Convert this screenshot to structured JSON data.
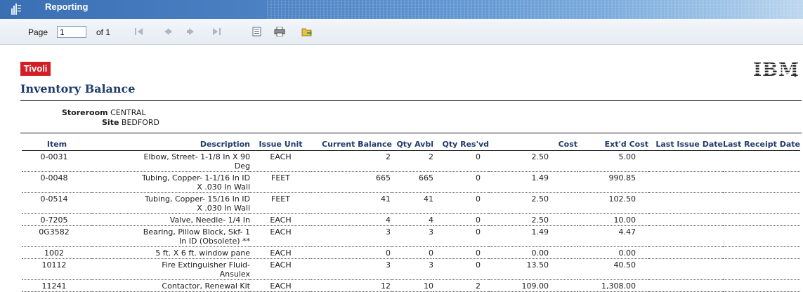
{
  "app": {
    "title": "Reporting"
  },
  "toolbar": {
    "page_label": "Page",
    "page_value": "1",
    "of_label": "of 1",
    "buttons": [
      "first-page",
      "previous-page",
      "next-page",
      "last-page",
      "table-of-contents",
      "print",
      "export"
    ]
  },
  "report": {
    "brand": "Tivoli",
    "vendor_logo": "IBM",
    "title": "Inventory Balance",
    "storeroom_label": "Storeroom",
    "storeroom_value": "CENTRAL",
    "site_label": "Site",
    "site_value": "BEDFORD",
    "columns": [
      "Item",
      "Description",
      "Issue Unit",
      "Current Balance",
      "Qty Avbl",
      "Qty Res'vd",
      "Cost",
      "Ext'd Cost",
      "Last Issue Date",
      "Last Receipt Date"
    ],
    "rows": [
      {
        "item": "0-0031",
        "desc1": "Elbow, Street- 1-1/8 In X 90",
        "desc2": "Deg",
        "unit": "EACH",
        "balance": "2",
        "avbl": "2",
        "resvd": "0",
        "cost": "2.50",
        "ext": "5.00",
        "last_issue": "",
        "last_receipt": ""
      },
      {
        "item": "0-0048",
        "desc1": "Tubing, Copper- 1-1/16 In ID",
        "desc2": "X .030 In Wall",
        "unit": "FEET",
        "balance": "665",
        "avbl": "665",
        "resvd": "0",
        "cost": "1.49",
        "ext": "990.85",
        "last_issue": "",
        "last_receipt": ""
      },
      {
        "item": "0-0514",
        "desc1": "Tubing, Copper- 15/16 In ID",
        "desc2": "X .030 In Wall",
        "unit": "FEET",
        "balance": "41",
        "avbl": "41",
        "resvd": "0",
        "cost": "2.50",
        "ext": "102.50",
        "last_issue": "",
        "last_receipt": ""
      },
      {
        "item": "0-7205",
        "desc1": "Valve, Needle- 1/4 In",
        "desc2": "",
        "unit": "EACH",
        "balance": "4",
        "avbl": "4",
        "resvd": "0",
        "cost": "2.50",
        "ext": "10.00",
        "last_issue": "",
        "last_receipt": ""
      },
      {
        "item": "0G3582",
        "desc1": "Bearing, Pillow Block, Skf- 1",
        "desc2": "In ID (Obsolete) **",
        "unit": "EACH",
        "balance": "3",
        "avbl": "3",
        "resvd": "0",
        "cost": "1.49",
        "ext": "4.47",
        "last_issue": "",
        "last_receipt": ""
      },
      {
        "item": "1002",
        "desc1": "5 ft. X 6 ft. window pane",
        "desc2": "",
        "unit": "EACH",
        "balance": "0",
        "avbl": "0",
        "resvd": "0",
        "cost": "0.00",
        "ext": "0.00",
        "last_issue": "",
        "last_receipt": ""
      },
      {
        "item": "10112",
        "desc1": "Fire Extinguisher Fluid-",
        "desc2": "Ansulex",
        "unit": "EACH",
        "balance": "3",
        "avbl": "3",
        "resvd": "0",
        "cost": "13.50",
        "ext": "40.50",
        "last_issue": "",
        "last_receipt": ""
      },
      {
        "item": "11241",
        "desc1": "Contactor, Renewal Kit",
        "desc2": "",
        "unit": "EACH",
        "balance": "12",
        "avbl": "10",
        "resvd": "2",
        "cost": "109.00",
        "ext": "1,308.00",
        "last_issue": "",
        "last_receipt": ""
      }
    ]
  },
  "colors": {
    "titlebar": "#3b6fb4",
    "brand_red": "#d21f26",
    "heading_blue": "#1f3c6b"
  }
}
